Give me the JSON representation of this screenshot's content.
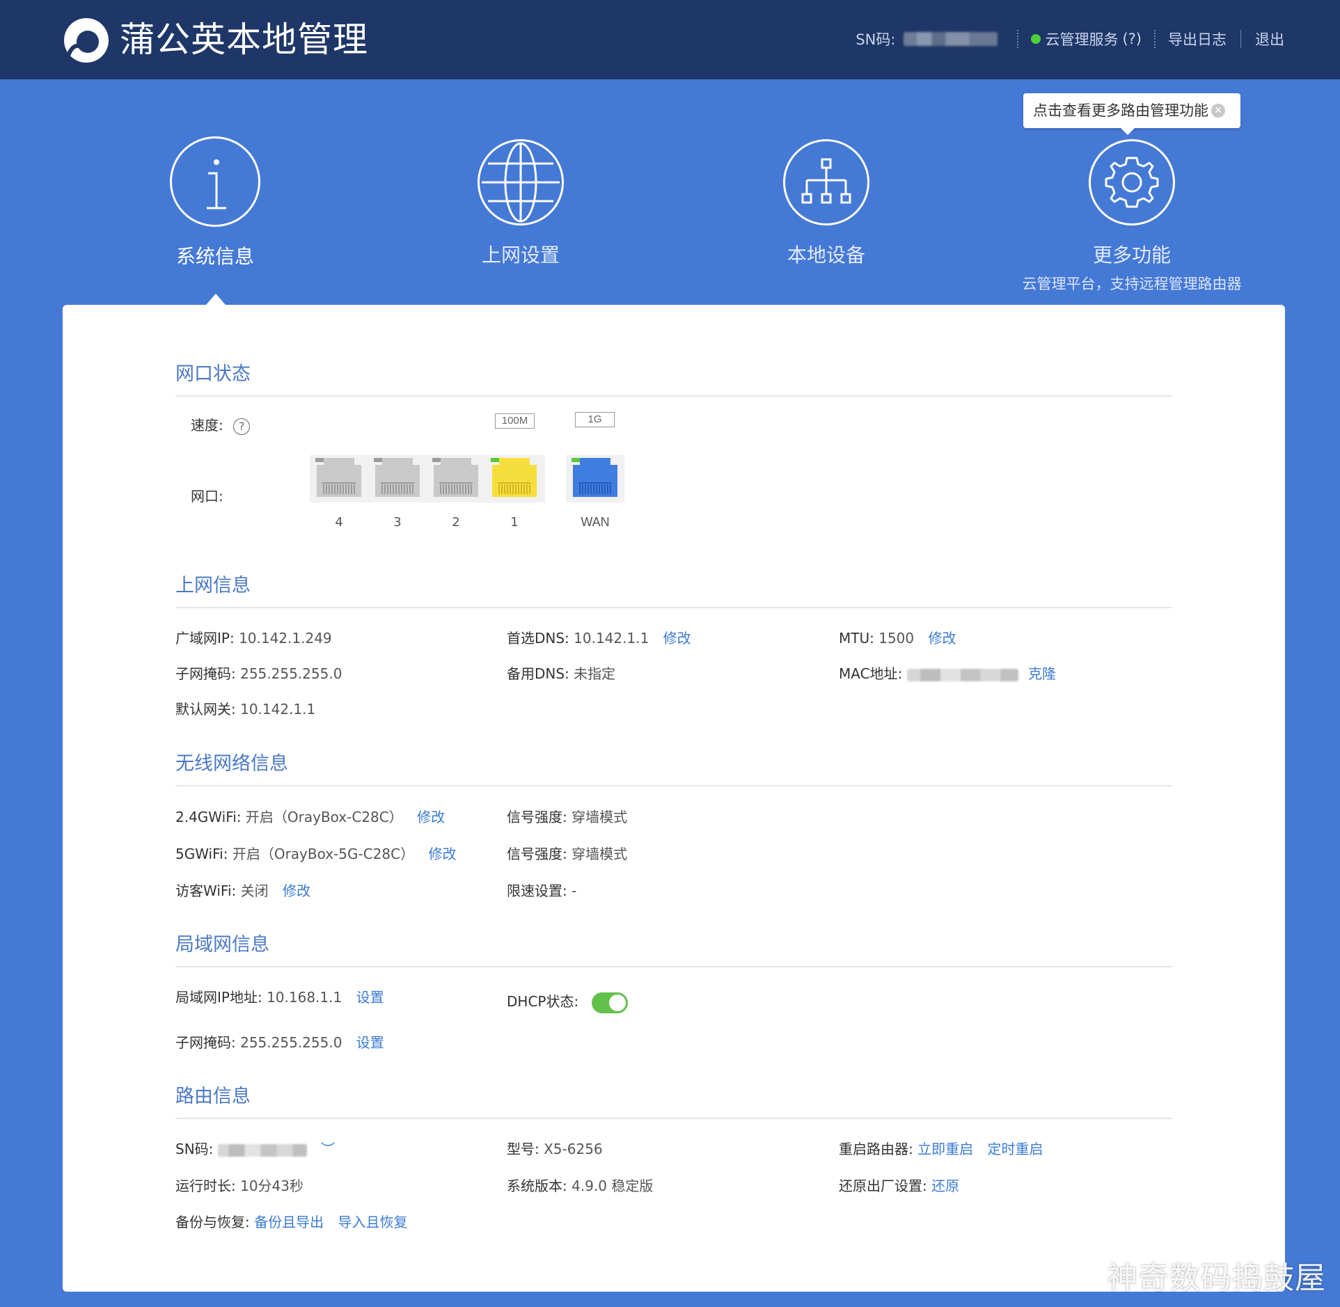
{
  "header": {
    "title": "蒲公英本地管理",
    "sn_label": "SN码:",
    "cloud_service": "云管理服务",
    "cloud_help": "(?)",
    "export_log": "导出日志",
    "logout": "退出"
  },
  "tooltip": {
    "text": "点击查看更多路由管理功能"
  },
  "nav": [
    {
      "label": "系统信息"
    },
    {
      "label": "上网设置"
    },
    {
      "label": "本地设备"
    },
    {
      "label": "更多功能",
      "sub": "云管理平台，支持远程管理路由器"
    }
  ],
  "port_status": {
    "title": "网口状态",
    "speed_label": "速度:",
    "ports_label": "网口:",
    "speed_tags": [
      "100M",
      "1G"
    ],
    "ports": [
      {
        "name": "4",
        "active": false
      },
      {
        "name": "3",
        "active": false
      },
      {
        "name": "2",
        "active": false
      },
      {
        "name": "1",
        "active": true,
        "color": "#f6df3c"
      },
      {
        "name": "WAN",
        "active": true,
        "color": "#3f7ee0"
      }
    ]
  },
  "internet": {
    "title": "上网信息",
    "wan_ip_label": "广域网IP:",
    "wan_ip": "10.142.1.249",
    "subnet_label": "子网掩码:",
    "subnet": "255.255.255.0",
    "gateway_label": "默认网关:",
    "gateway": "10.142.1.1",
    "dns1_label": "首选DNS:",
    "dns1": "10.142.1.1",
    "dns2_label": "备用DNS:",
    "dns2": "未指定",
    "mtu_label": "MTU:",
    "mtu": "1500",
    "mac_label": "MAC地址:",
    "modify": "修改",
    "clone": "克隆"
  },
  "wireless": {
    "title": "无线网络信息",
    "wifi24_label": "2.4GWiFi:",
    "wifi24": "开启（OrayBox-C28C）",
    "wifi5_label": "5GWiFi:",
    "wifi5": "开启（OrayBox-5G-C28C）",
    "guest_label": "访客WiFi:",
    "guest": "关闭",
    "signal_label": "信号强度:",
    "signal": "穿墙模式",
    "limit_label": "限速设置:",
    "limit": "-",
    "modify": "修改"
  },
  "lan": {
    "title": "局域网信息",
    "ip_label": "局域网IP地址:",
    "ip": "10.168.1.1",
    "subnet_label": "子网掩码:",
    "subnet": "255.255.255.0",
    "dhcp_label": "DHCP状态:",
    "dhcp_on": true,
    "set": "设置"
  },
  "router": {
    "title": "路由信息",
    "sn_label": "SN码:",
    "model_label": "型号:",
    "model": "X5-6256",
    "reboot_label": "重启路由器:",
    "reboot_now": "立即重启",
    "reboot_timed": "定时重启",
    "uptime_label": "运行时长:",
    "uptime": "10分43秒",
    "version_label": "系统版本:",
    "version": "4.9.0 稳定版",
    "reset_label": "还原出厂设置:",
    "reset": "还原",
    "backup_label": "备份与恢复:",
    "backup_export": "备份且导出",
    "import_restore": "导入且恢复"
  },
  "watermark": "神奇数码捣鼓屋"
}
